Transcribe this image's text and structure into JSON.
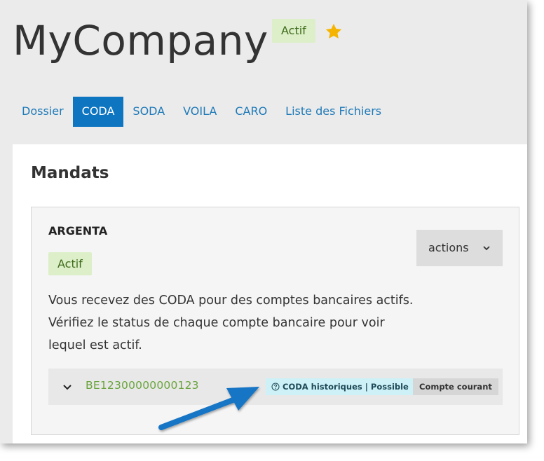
{
  "header": {
    "company_name": "MyCompany",
    "status": "Actif",
    "star_color": "#f5b400"
  },
  "tabs": [
    {
      "label": "Dossier",
      "active": false
    },
    {
      "label": "CODA",
      "active": true
    },
    {
      "label": "SODA",
      "active": false
    },
    {
      "label": "VOILA",
      "active": false
    },
    {
      "label": "CARO",
      "active": false
    },
    {
      "label": "Liste des Fichiers",
      "active": false
    }
  ],
  "section": {
    "title": "Mandats"
  },
  "mandate": {
    "bank": "ARGENTA",
    "status": "Actif",
    "actions_label": "actions",
    "description_lines": [
      "Vous recevez des CODA pour des comptes bancaires actifs.",
      "Vérifiez le status de chaque compte bancaire pour voir",
      "lequel est actif."
    ],
    "account": {
      "number": "BE12300000000123",
      "coda_badge": "CODA historiques | Possible",
      "type_badge": "Compte courant"
    }
  },
  "colors": {
    "accent": "#0e75c1",
    "status_bg": "#dcefc8",
    "account_link": "#6aa43c",
    "coda_badge_bg": "#cdf1f7",
    "annotation_arrow": "#1474c4"
  },
  "icons": {
    "star": "star-icon",
    "actions_chevron": "chevron-down-icon",
    "row_chevron": "chevron-down-icon",
    "help": "help-circle-icon",
    "annotation": "arrow-annotation"
  }
}
